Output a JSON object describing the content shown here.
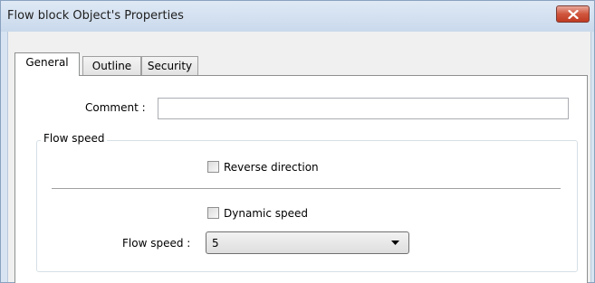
{
  "window": {
    "title": "Flow block Object's Properties",
    "close_icon": "close-x-icon",
    "close_color": "#c7432a"
  },
  "tabs": [
    {
      "label": "General",
      "active": true
    },
    {
      "label": "Outline",
      "active": false
    },
    {
      "label": "Security",
      "active": false
    }
  ],
  "general": {
    "comment_label": "Comment :",
    "comment_value": "",
    "flow_speed_group": {
      "title": "Flow speed",
      "reverse_direction_label": "Reverse direction",
      "reverse_direction_checked": false,
      "dynamic_speed_label": "Dynamic speed",
      "dynamic_speed_checked": false,
      "flow_speed_label": "Flow speed :",
      "flow_speed_value": "5",
      "dropdown_icon": "chevron-down-icon"
    }
  }
}
